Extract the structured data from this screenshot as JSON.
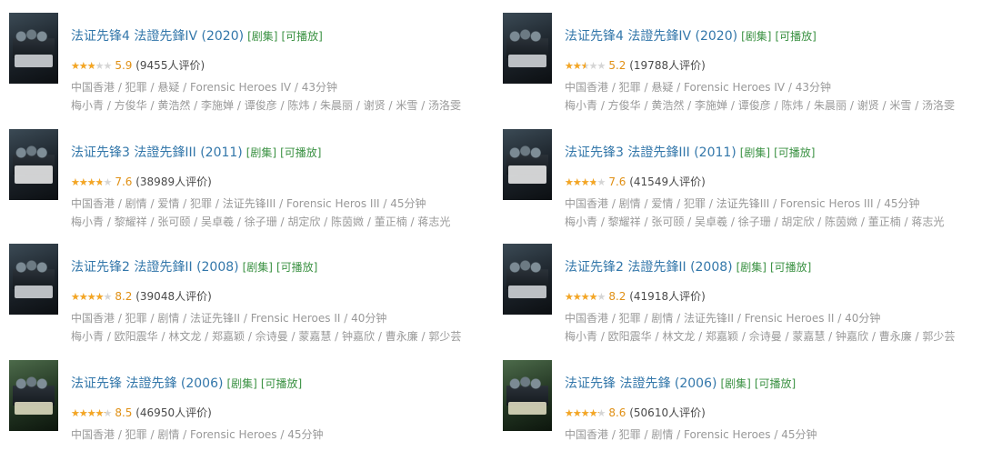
{
  "columns": [
    {
      "items": [
        {
          "title": "法证先锋4 法證先鋒IV (2020)",
          "type_tag": "[剧集]",
          "play_tag": "[可播放]",
          "score": "5.9",
          "rating_fraction": 0.59,
          "votes": "(9455人评价)",
          "meta": "中国香港 / 犯罪 / 悬疑 / Forensic Heroes IV / 43分钟",
          "cast": "梅小青 / 方俊华 / 黄浩然 / 李施婵 / 谭俊彦 / 陈炜 / 朱晨丽 / 谢贤 / 米雪 / 汤洛雯"
        },
        {
          "title": "法证先锋3 法證先鋒III (2011)",
          "type_tag": "[剧集]",
          "play_tag": "[可播放]",
          "score": "7.6",
          "rating_fraction": 0.76,
          "votes": "(38989人评价)",
          "meta": "中国香港 / 剧情 / 爱情 / 犯罪 / 法证先锋III / Forensic Heros III / 45分钟",
          "cast": "梅小青 / 黎耀祥 / 张可颐 / 吴卓羲 / 徐子珊 / 胡定欣 / 陈茵媺 / 董正楠 / 蒋志光"
        },
        {
          "title": "法证先锋2 法證先鋒II (2008)",
          "type_tag": "[剧集]",
          "play_tag": "[可播放]",
          "score": "8.2",
          "rating_fraction": 0.82,
          "votes": "(39048人评价)",
          "meta": "中国香港 / 犯罪 / 剧情 / 法证先锋II / Frensic Heroes II / 40分钟",
          "cast": "梅小青 / 欧阳震华 / 林文龙 / 郑嘉颖 / 佘诗曼 / 蒙嘉慧 / 钟嘉欣 / 曹永廉 / 郭少芸"
        },
        {
          "title": "法证先锋 法證先鋒 (2006)",
          "type_tag": "[剧集]",
          "play_tag": "[可播放]",
          "score": "8.5",
          "rating_fraction": 0.85,
          "votes": "(46950人评价)",
          "meta": "中国香港 / 犯罪 / 剧情 / Forensic Heroes / 45分钟",
          "cast": ""
        }
      ]
    },
    {
      "items": [
        {
          "title": "法证先锋4 法證先鋒IV (2020)",
          "type_tag": "[剧集]",
          "play_tag": "[可播放]",
          "score": "5.2",
          "rating_fraction": 0.52,
          "votes": "(19788人评价)",
          "meta": "中国香港 / 犯罪 / 悬疑 / Forensic Heroes IV / 43分钟",
          "cast": "梅小青 / 方俊华 / 黄浩然 / 李施婵 / 谭俊彦 / 陈炜 / 朱晨丽 / 谢贤 / 米雪 / 汤洛雯"
        },
        {
          "title": "法证先锋3 法證先鋒III (2011)",
          "type_tag": "[剧集]",
          "play_tag": "[可播放]",
          "score": "7.6",
          "rating_fraction": 0.76,
          "votes": "(41549人评价)",
          "meta": "中国香港 / 剧情 / 爱情 / 犯罪 / 法证先锋III / Forensic Heros III / 45分钟",
          "cast": "梅小青 / 黎耀祥 / 张可颐 / 吴卓羲 / 徐子珊 / 胡定欣 / 陈茵媺 / 董正楠 / 蒋志光"
        },
        {
          "title": "法证先锋2 法證先鋒II (2008)",
          "type_tag": "[剧集]",
          "play_tag": "[可播放]",
          "score": "8.2",
          "rating_fraction": 0.82,
          "votes": "(41918人评价)",
          "meta": "中国香港 / 犯罪 / 剧情 / 法证先锋II / Frensic Heroes II / 40分钟",
          "cast": "梅小青 / 欧阳震华 / 林文龙 / 郑嘉颖 / 佘诗曼 / 蒙嘉慧 / 钟嘉欣 / 曹永廉 / 郭少芸"
        },
        {
          "title": "法证先锋 法證先鋒 (2006)",
          "type_tag": "[剧集]",
          "play_tag": "[可播放]",
          "score": "8.6",
          "rating_fraction": 0.86,
          "votes": "(50610人评价)",
          "meta": "中国香港 / 犯罪 / 剧情 / Forensic Heroes / 45分钟",
          "cast": ""
        }
      ]
    }
  ],
  "colors": {
    "link": "#3377aa",
    "tag": "#3a9142",
    "star": "#f5a623",
    "score": "#e09015",
    "meta": "#999999"
  }
}
